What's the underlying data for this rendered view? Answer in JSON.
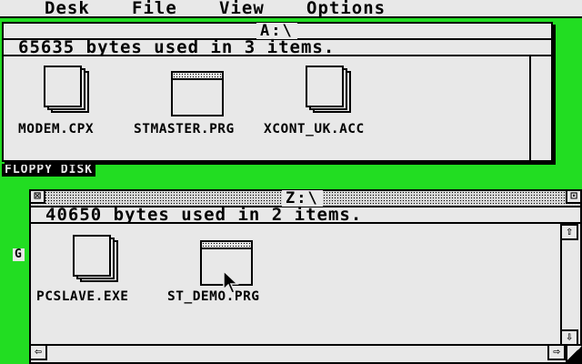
{
  "menubar": {
    "items": [
      "Desk",
      "File",
      "View",
      "Options"
    ]
  },
  "window_a": {
    "title": "A:\\",
    "info": "65635 bytes used in 3 items.",
    "icons": [
      {
        "label": "MODEM.CPX",
        "type": "document"
      },
      {
        "label": "STMASTER.PRG",
        "type": "program"
      },
      {
        "label": "XCONT_UK.ACC",
        "type": "document"
      }
    ]
  },
  "window_z": {
    "title": "Z:\\",
    "info": "40650 bytes used in 2 items.",
    "icons": [
      {
        "label": "PCSLAVE.EXE",
        "type": "document"
      },
      {
        "label": "ST_DEMO.PRG",
        "type": "program"
      }
    ],
    "gadgets": {
      "close": "⊠",
      "fuller": "⊡",
      "up": "⇧",
      "down": "⇩",
      "left": "⇦",
      "right": "⇨"
    }
  },
  "desktop": {
    "floppy_label": "FLOPPY DISK",
    "partial_label": "G"
  },
  "colors": {
    "desktop": "#22dd22",
    "window": "#e8e8e8",
    "ink": "#000000"
  }
}
